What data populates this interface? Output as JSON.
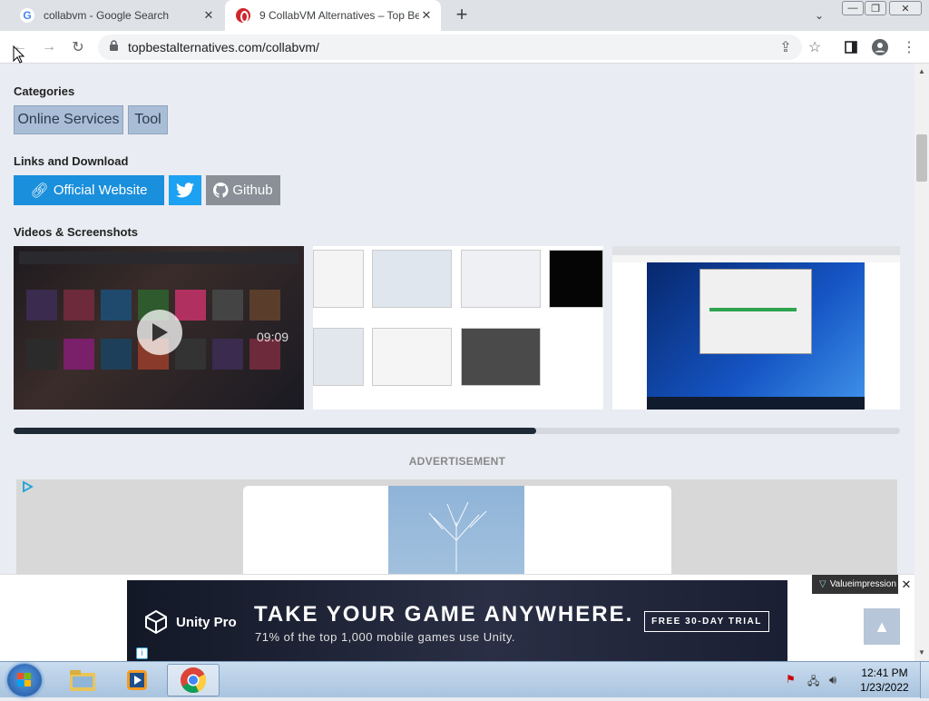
{
  "tabs": [
    {
      "title": "collabvm - Google Search",
      "icon": "google-icon"
    },
    {
      "title": "9 CollabVM Alternatives – Top Be",
      "icon": "collabvm-icon"
    }
  ],
  "new_tab_label": "+",
  "window_controls": [
    "minimize",
    "maximize",
    "close"
  ],
  "address_bar": {
    "url": "topbestalternatives.com/collabvm/"
  },
  "page": {
    "categories_heading": "Categories",
    "categories": [
      "Online Services",
      "Tool"
    ],
    "links_heading": "Links and Download",
    "official_website": "Official Website",
    "github": "Github",
    "videos_heading": "Videos & Screenshots",
    "video_time": "09:09",
    "ad_label": "ADVERTISEMENT",
    "screenshots_scroll_fraction": 0.59
  },
  "banner": {
    "brand": "Unity Pro",
    "headline": "TAKE YOUR GAME ANYWHERE.",
    "subline": "71% of the top 1,000 mobile games use Unity.",
    "cta": "FREE 30-DAY TRIAL",
    "network": "Valueimpression"
  },
  "taskbar": {
    "time": "12:41 PM",
    "date": "1/23/2022",
    "apps": [
      "windows-explorer-icon",
      "media-player-icon",
      "chrome-icon"
    ]
  },
  "colors": {
    "accent": "#1a8fdc",
    "twitter": "#1da1f2",
    "github": "#8a8f98",
    "chip": "#a9bed6"
  }
}
